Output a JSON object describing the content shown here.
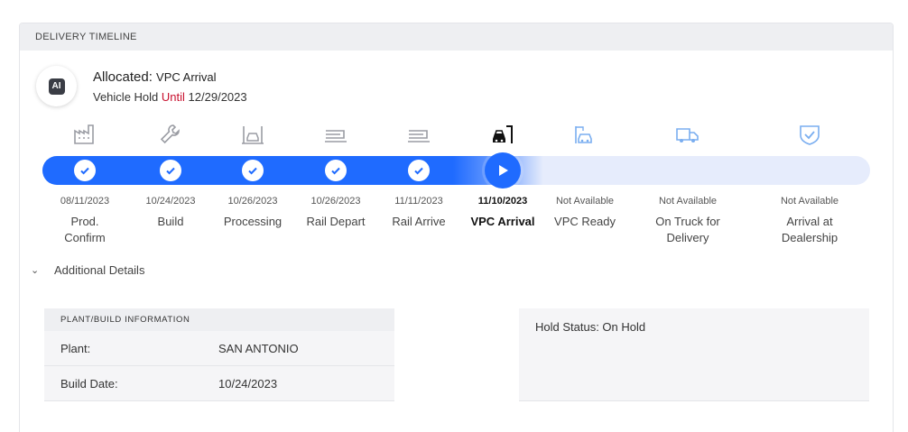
{
  "header": {
    "title": "DELIVERY TIMELINE"
  },
  "status": {
    "badge": "AI",
    "allocated_label": "Allocated:",
    "allocated_value": "VPC Arrival",
    "hold_prefix": "Vehicle Hold",
    "hold_until": "Until",
    "hold_date": "12/29/2023"
  },
  "steps": [
    {
      "date": "08/11/2023",
      "label": "Prod. Confirm",
      "icon": "factory-icon",
      "state": "done"
    },
    {
      "date": "10/24/2023",
      "label": "Build",
      "icon": "wrench-icon",
      "state": "done"
    },
    {
      "date": "10/26/2023",
      "label": "Processing",
      "icon": "car-lift-icon",
      "state": "done"
    },
    {
      "date": "10/26/2023",
      "label": "Rail Depart",
      "icon": "railcar-icon",
      "state": "done"
    },
    {
      "date": "11/11/2023",
      "label": "Rail Arrive",
      "icon": "railcar-icon",
      "state": "done"
    },
    {
      "date": "11/10/2023",
      "label": "VPC Arrival",
      "icon": "car-port-icon",
      "state": "current"
    },
    {
      "date": "Not Available",
      "label": "VPC Ready",
      "icon": "car-ready-icon",
      "state": "pending"
    },
    {
      "date": "Not Available",
      "label": "On Truck for Delivery",
      "icon": "truck-icon",
      "state": "pending"
    },
    {
      "date": "Not Available",
      "label": "Arrival at Dealership",
      "icon": "shield-check-icon",
      "state": "pending"
    }
  ],
  "details": {
    "toggle_label": "Additional Details"
  },
  "plant_info": {
    "title": "PLANT/BUILD INFORMATION",
    "rows": [
      {
        "key": "Plant:",
        "value": "SAN ANTONIO"
      },
      {
        "key": "Build Date:",
        "value": "10/24/2023"
      }
    ]
  },
  "hold_status": {
    "text": "Hold Status: On Hold"
  },
  "colors": {
    "accent": "#1f6bff",
    "track": "#e6ecfc",
    "until": "#c8102e",
    "icon_done": "#9a9ca3",
    "icon_pending": "#7aaef0"
  }
}
